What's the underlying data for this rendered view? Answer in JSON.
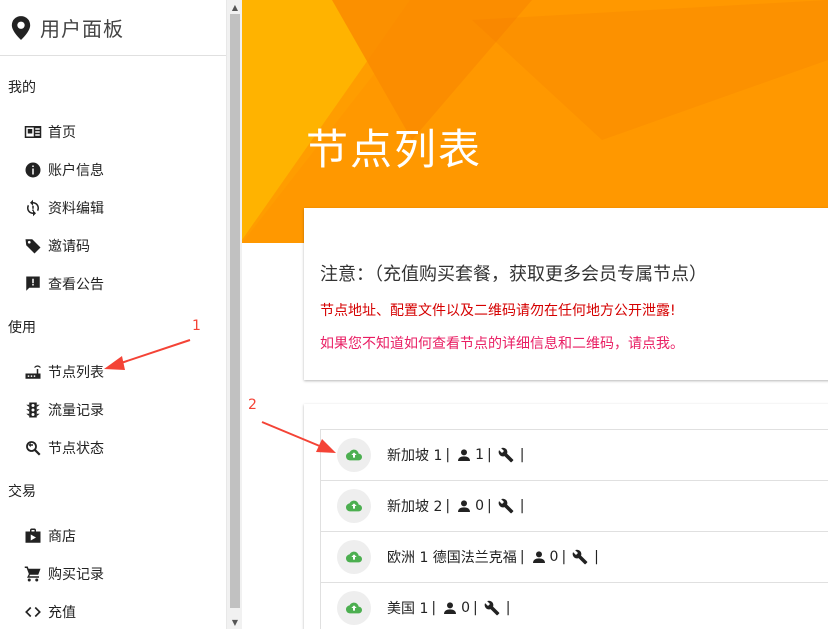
{
  "sidebar": {
    "title": "用户面板",
    "sections": [
      {
        "label": "我的",
        "items": [
          {
            "label": "首页",
            "icon": "contact-card-icon"
          },
          {
            "label": "账户信息",
            "icon": "info-icon"
          },
          {
            "label": "资料编辑",
            "icon": "sync-icon"
          },
          {
            "label": "邀请码",
            "icon": "tag-icon"
          },
          {
            "label": "查看公告",
            "icon": "announcement-icon"
          }
        ]
      },
      {
        "label": "使用",
        "items": [
          {
            "label": "节点列表",
            "icon": "router-icon"
          },
          {
            "label": "流量记录",
            "icon": "traffic-light-icon"
          },
          {
            "label": "节点状态",
            "icon": "find-replace-icon"
          }
        ]
      },
      {
        "label": "交易",
        "items": [
          {
            "label": "商店",
            "icon": "shop-icon"
          },
          {
            "label": "购买记录",
            "icon": "cart-icon"
          },
          {
            "label": "充值",
            "icon": "code-icon"
          }
        ]
      }
    ]
  },
  "main": {
    "banner_title": "节点列表",
    "notice": {
      "heading": "注意：（充值购买套餐，获取更多会员专属节点）",
      "warning": "节点地址、配置文件以及二维码请勿在任何地方公开泄露!",
      "help": "如果您不知道如何查看节点的详细信息和二维码，请点我。"
    },
    "nodes": [
      {
        "name": "新加坡 1",
        "users": "1"
      },
      {
        "name": "新加坡 2",
        "users": "0"
      },
      {
        "name": "欧洲 1 德国法兰克福",
        "users": "0"
      },
      {
        "name": "美国 1",
        "users": "0"
      }
    ],
    "separator": "|"
  },
  "annotations": {
    "label_1": "1",
    "label_2": "2"
  },
  "colors": {
    "banner_orange": "#ff9800",
    "banner_yellow": "#ffb300",
    "warning_red": "#d50000",
    "help_pink": "#e91e63",
    "cloud_green": "#4caf50",
    "annotation_red": "#f44336"
  }
}
